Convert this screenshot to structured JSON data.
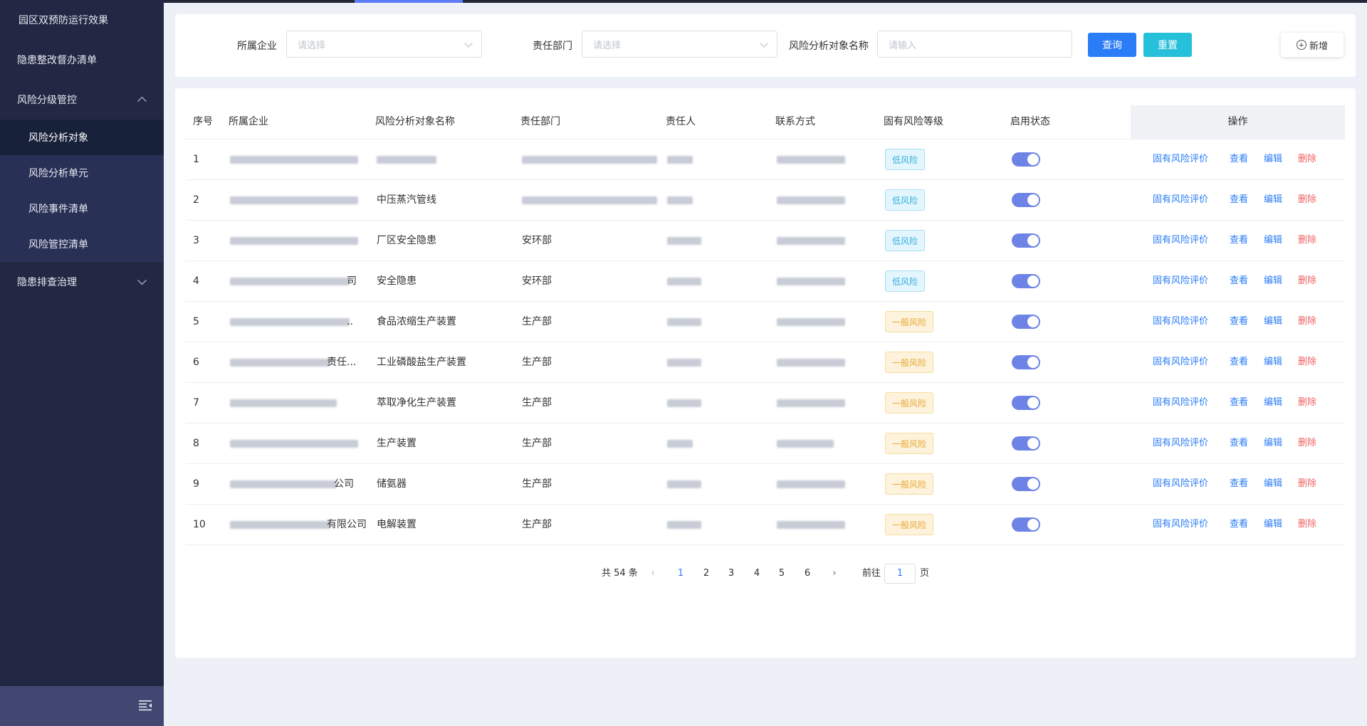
{
  "sidebar": {
    "items": [
      {
        "label": "园区双预防运行效果"
      },
      {
        "label": "隐患整改督办清单"
      },
      {
        "label": "风险分级管控",
        "expanded": true
      },
      {
        "label": "隐患排查治理",
        "expanded": false
      }
    ],
    "submenu": [
      {
        "label": "风险分析对象",
        "active": true
      },
      {
        "label": "风险分析单元"
      },
      {
        "label": "风险事件清单"
      },
      {
        "label": "风险管控清单"
      }
    ],
    "collapse_icon": "menu-fold-icon"
  },
  "filter": {
    "company_label": "所属企业",
    "company_placeholder": "请选择",
    "dept_label": "责任部门",
    "dept_placeholder": "请选择",
    "object_label": "风险分析对象名称",
    "object_placeholder": "请输入",
    "query_label": "查询",
    "reset_label": "重置",
    "add_label": "新增"
  },
  "table": {
    "headers": {
      "index": "序号",
      "company": "所属企业",
      "object": "风险分析对象名称",
      "dept": "责任部门",
      "person": "责任人",
      "contact": "联系方式",
      "risk": "固有风险等级",
      "status": "启用状态",
      "ops": "操作"
    },
    "ops": {
      "evaluate": "固有风险评价",
      "view": "查看",
      "edit": "编辑",
      "delete": "删除"
    },
    "rows": [
      {
        "index": "1",
        "company_suffix": "",
        "object": "",
        "dept": "",
        "risk": "低风险",
        "risk_level": "low",
        "enabled": true
      },
      {
        "index": "2",
        "company_suffix": "",
        "object": "中压蒸汽管线",
        "dept": "",
        "risk": "低风险",
        "risk_level": "low",
        "enabled": true
      },
      {
        "index": "3",
        "company_suffix": "",
        "object": "厂区安全隐患",
        "dept": "安环部",
        "risk": "低风险",
        "risk_level": "low",
        "enabled": true
      },
      {
        "index": "4",
        "company_suffix": "司",
        "object": "安全隐患",
        "dept": "安环部",
        "risk": "低风险",
        "risk_level": "low",
        "enabled": true
      },
      {
        "index": "5",
        "company_suffix": "..",
        "object": "食品浓缩生产装置",
        "dept": "生产部",
        "risk": "一般风险",
        "risk_level": "mid",
        "enabled": true
      },
      {
        "index": "6",
        "company_suffix": "责任...",
        "object": "工业磷酸盐生产装置",
        "dept": "生产部",
        "risk": "一般风险",
        "risk_level": "mid",
        "enabled": true
      },
      {
        "index": "7",
        "company_suffix": "",
        "object": "萃取净化生产装置",
        "dept": "生产部",
        "risk": "一般风险",
        "risk_level": "mid",
        "enabled": true
      },
      {
        "index": "8",
        "company_suffix": "",
        "object": "生产装置",
        "dept": "生产部",
        "risk": "一般风险",
        "risk_level": "mid",
        "enabled": true
      },
      {
        "index": "9",
        "company_suffix": "公司",
        "object": "储氨器",
        "dept": "生产部",
        "risk": "一般风险",
        "risk_level": "mid",
        "enabled": true
      },
      {
        "index": "10",
        "company_suffix": "有限公司",
        "object": "电解装置",
        "dept": "生产部",
        "risk": "一般风险",
        "risk_level": "mid",
        "enabled": true
      }
    ]
  },
  "pagination": {
    "total_text": "共 54 条",
    "pages": [
      "1",
      "2",
      "3",
      "4",
      "5",
      "6"
    ],
    "current": "1",
    "goto_label": "前往",
    "goto_value": "1",
    "page_suffix": "页"
  },
  "colors": {
    "sidebar_bg": "#222843",
    "primary": "#2a7cf7",
    "reset": "#27c0da",
    "danger": "#f06060",
    "switch_on": "#6d84e6"
  }
}
